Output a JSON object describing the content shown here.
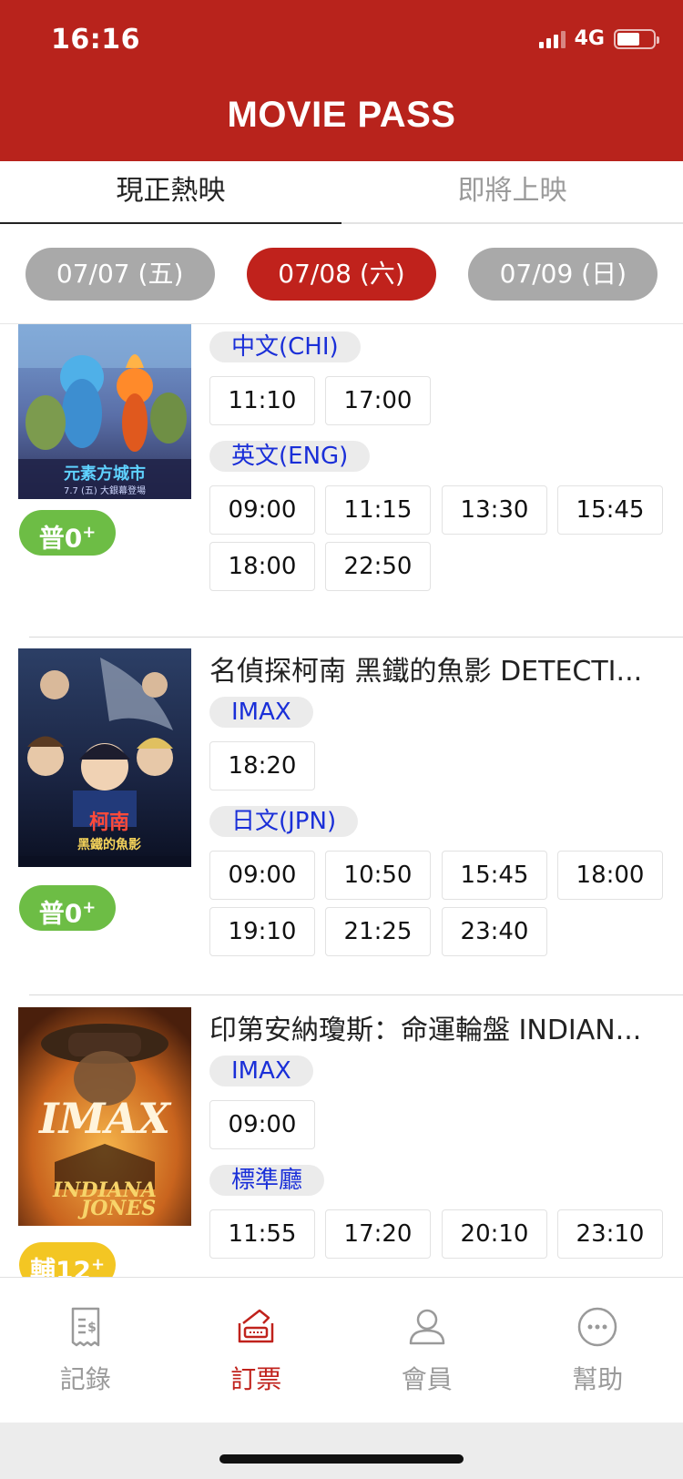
{
  "status_bar": {
    "time": "16:16",
    "network": "4G"
  },
  "header": {
    "title": "MOVIE PASS"
  },
  "tabs": [
    {
      "label": "現正熱映",
      "active": true
    },
    {
      "label": "即將上映",
      "active": false
    }
  ],
  "dates": [
    {
      "label": "07/07 (五)",
      "active": false
    },
    {
      "label": "07/08 (六)",
      "active": true
    },
    {
      "label": "07/09 (日)",
      "active": false
    }
  ],
  "movies": [
    {
      "title": "",
      "rating": {
        "label": "普0",
        "sup": "+",
        "color": "#6dbd45"
      },
      "sessions": [
        {
          "format": "中文(CHI)",
          "times": [
            "11:10",
            "17:00"
          ]
        },
        {
          "format": "英文(ENG)",
          "times": [
            "09:00",
            "11:15",
            "13:30",
            "15:45",
            "18:00",
            "22:50"
          ]
        }
      ]
    },
    {
      "title": "名偵探柯南 黑鐵的魚影 DETECTI...",
      "rating": {
        "label": "普0",
        "sup": "+",
        "color": "#6dbd45"
      },
      "sessions": [
        {
          "format": "IMAX",
          "times": [
            "18:20"
          ]
        },
        {
          "format": "日文(JPN)",
          "times": [
            "09:00",
            "10:50",
            "15:45",
            "18:00",
            "19:10",
            "21:25",
            "23:40"
          ]
        }
      ]
    },
    {
      "title": "印第安納瓊斯：命運輪盤 INDIAN...",
      "rating": {
        "label": "輔12",
        "sup": "+",
        "color": "#f3c623"
      },
      "sessions": [
        {
          "format": "IMAX",
          "times": [
            "09:00"
          ]
        },
        {
          "format": "標準廳",
          "times": [
            "11:55",
            "17:20",
            "20:10",
            "23:10"
          ]
        }
      ]
    }
  ],
  "bottom_nav": [
    {
      "label": "記錄",
      "icon": "receipt-icon",
      "active": false
    },
    {
      "label": "訂票",
      "icon": "ticket-icon",
      "active": true
    },
    {
      "label": "會員",
      "icon": "user-icon",
      "active": false
    },
    {
      "label": "幫助",
      "icon": "help-chat-icon",
      "active": false
    }
  ],
  "colors": {
    "brand_red": "#b8231c",
    "format_text": "#1a2fd8"
  }
}
